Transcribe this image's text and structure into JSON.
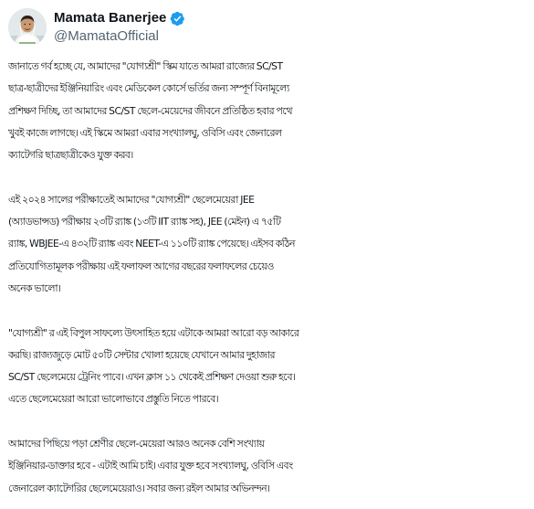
{
  "author": {
    "display_name": "Mamata Banerjee",
    "handle": "@MamataOfficial",
    "verified": true,
    "avatar_icon": "profile-photo",
    "verified_color": "#1d9bf0"
  },
  "tweet": {
    "paragraphs": [
      [
        "জানাতে গর্ব হচ্ছে যে,  আমাদের \"যোগ্যশ্রী\" স্কিম যাতে আমরা রাজ্যের SC/ST",
        "ছাত্র-ছাত্রীদের ইঞ্জিনিয়ারিং এবং মেডিকেল কোর্সে ভর্তির জন্য সম্পূর্ণ বিনামূল্যে",
        "প্রশিক্ষণ দিচ্ছি, তা আমাদের SC/ST ছেলে-মেয়েদের জীবনে প্রতিষ্ঠিত হবার পথে",
        "খুবই কাজে লাগছে। এই স্কিমে আমরা এবার সংখ্যালঘু, ওবিসি এবং জেনারেল",
        "ক্যাটেগরি ছাত্রছাত্রীকেও যুক্ত করব।"
      ],
      [
        "এই ২০২৪ সালের পরীক্ষাতেই আমাদের \"যোগ্যশ্রী\" ছেলেমেয়েরা JEE",
        "(অ্যাডভান্সড) পরীক্ষায় ২৩টি র‍্যাঙ্ক (১৩টি IIT র‍্যাঙ্ক সহ), JEE (মেইন) এ ৭৫টি",
        "র‍্যাঙ্ক, WBJEE-এ ৪৩২টি র‍্যাঙ্ক এবং NEET-এ ১১০টি র‍্যাঙ্ক পেয়েছে।  এইসব কঠিন",
        "প্রতিযোগিতামূলক পরীক্ষায় এই ফলাফল আগের বছরের ফলাফলের চেয়েও",
        "অনেক ভালো।"
      ],
      [
        "\"যোগ্যশ্রী\" র এই বিপুল সাফল্যে উৎসাহিত হয়ে এটাকে আমরা আরো বড় আকারে",
        "করছি। রাজ্যজুড়ে মোট ৫০টি সেন্টার খোলা হয়েছে যেখানে আমার দুহাজার",
        "SC/ST ছেলেমেয়ে ট্রেনিং পাবে। এখন ক্লাস ১১ থেকেই প্রশিক্ষণ দেওয়া শুরু হবে।",
        "এতে ছেলেমেয়েরা আরো ভালোভাবে প্রস্তুতি নিতে পারবে।"
      ],
      [
        "আমাদের পিছিয়ে পড়া শ্রেণীর ছেলে-মেয়েরা আরও অনেক বেশি সংখ্যায়",
        "ইঞ্জিনিয়ার-ডাক্তার হবে - এটাই আমি চাই। এবার যুক্ত হবে সংখ্যালঘু, ওবিসি এবং",
        "জেনারেল ক্যাটেগরির ছেলেমেয়েরাও। সবার জন্য রইল আমার অভিনন্দন।"
      ]
    ]
  }
}
